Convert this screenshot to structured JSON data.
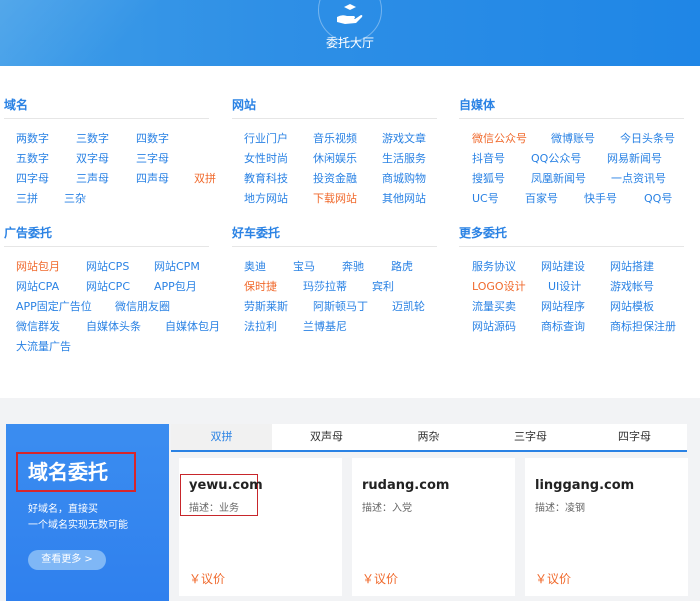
{
  "banner": {
    "title": "委托大厅",
    "icon": "hand-icon"
  },
  "groups": {
    "domain": {
      "title": "域名",
      "links": [
        "两数字",
        "三数字",
        "四数字",
        "五数字",
        "双字母",
        "三字母",
        "四字母",
        "三声母",
        "四声母",
        "双拼",
        "三拼",
        "三杂"
      ]
    },
    "website": {
      "title": "网站",
      "links": [
        "行业门户",
        "音乐视频",
        "游戏文章",
        "女性时尚",
        "休闲娱乐",
        "生活服务",
        "教育科技",
        "投资金融",
        "商城购物",
        "地方网站",
        "下载网站",
        "其他网站"
      ]
    },
    "media": {
      "title": "自媒体",
      "links": [
        "微信公众号",
        "微博账号",
        "今日头条号",
        "抖音号",
        "QQ公众号",
        "网易新闻号",
        "搜狐号",
        "凤凰新闻号",
        "一点资讯号",
        "UC号",
        "百家号",
        "快手号",
        "QQ号"
      ]
    },
    "ads": {
      "title": "广告委托",
      "links": [
        "网站包月",
        "网站CPS",
        "网站CPM",
        "网站CPA",
        "网站CPC",
        "APP包月",
        "APP固定广告位",
        "微信朋友圈",
        "微信群发",
        "自媒体头条",
        "自媒体包月",
        "大流量广告"
      ]
    },
    "cars": {
      "title": "好车委托",
      "links": [
        "奥迪",
        "宝马",
        "奔驰",
        "路虎",
        "保时捷",
        "玛莎拉蒂",
        "宾利",
        "劳斯莱斯",
        "阿斯顿马丁",
        "迈凯轮",
        "法拉利",
        "兰博基尼"
      ]
    },
    "more": {
      "title": "更多委托",
      "links": [
        "服务协议",
        "网站建设",
        "网站搭建",
        "LOGO设计",
        "UI设计",
        "游戏帐号",
        "流量买卖",
        "网站程序",
        "网站模板",
        "网站源码",
        "商标查询",
        "商标担保注册"
      ]
    }
  },
  "promo": {
    "title": "域名委托",
    "line1": "好域名，直接买",
    "line2": "一个域名实现无数可能",
    "button": "查看更多 >"
  },
  "tabs": [
    "双拼",
    "双声母",
    "两杂",
    "三字母",
    "四字母"
  ],
  "cards": [
    {
      "domain": "yewu.com",
      "desc": "描述：业务",
      "price": "￥议价"
    },
    {
      "domain": "rudang.com",
      "desc": "描述：入党",
      "price": "￥议价"
    },
    {
      "domain": "linggang.com",
      "desc": "描述：凌钢",
      "price": "￥议价"
    }
  ],
  "colors": {
    "accent": "#2a82e4",
    "hot": "#f06a2d",
    "annotation": "#c7262b"
  }
}
